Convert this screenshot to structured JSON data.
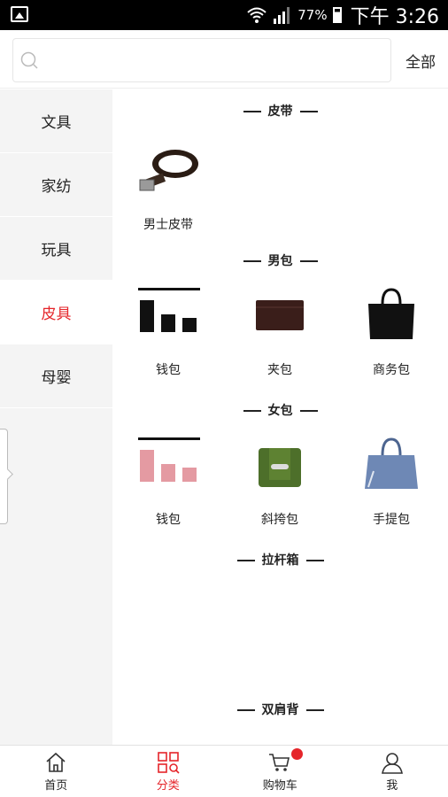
{
  "status_bar": {
    "battery": "77%",
    "time": "下午 3:26"
  },
  "search": {
    "placeholder": "",
    "all_label": "全部"
  },
  "sidebar": {
    "items": [
      {
        "label": "文具",
        "active": false
      },
      {
        "label": "家纺",
        "active": false
      },
      {
        "label": "玩具",
        "active": false
      },
      {
        "label": "皮具",
        "active": true
      },
      {
        "label": "母婴",
        "active": false
      }
    ]
  },
  "sections": [
    {
      "title": "皮带",
      "items": [
        {
          "label": "男士皮带",
          "icon": "belt-icon"
        }
      ]
    },
    {
      "title": "男包",
      "items": [
        {
          "label": "钱包",
          "icon": "wallet-chart-icon"
        },
        {
          "label": "夹包",
          "icon": "clutch-icon"
        },
        {
          "label": "商务包",
          "icon": "business-bag-icon"
        }
      ]
    },
    {
      "title": "女包",
      "items": [
        {
          "label": "钱包",
          "icon": "wallet-chart-pink-icon"
        },
        {
          "label": "斜挎包",
          "icon": "crossbody-bag-icon"
        },
        {
          "label": "手提包",
          "icon": "handbag-icon"
        }
      ]
    },
    {
      "title": "拉杆箱",
      "items": []
    },
    {
      "title": "双肩背",
      "items": []
    }
  ],
  "bottom_nav": {
    "items": [
      {
        "label": "首页",
        "icon": "home-icon",
        "active": false
      },
      {
        "label": "分类",
        "icon": "category-grid-icon",
        "active": true
      },
      {
        "label": "购物车",
        "icon": "cart-icon",
        "active": false,
        "badge": true
      },
      {
        "label": "我",
        "icon": "user-icon",
        "active": false
      }
    ]
  },
  "colors": {
    "accent": "#e5252a",
    "sidebar_bg": "#f4f4f4"
  }
}
